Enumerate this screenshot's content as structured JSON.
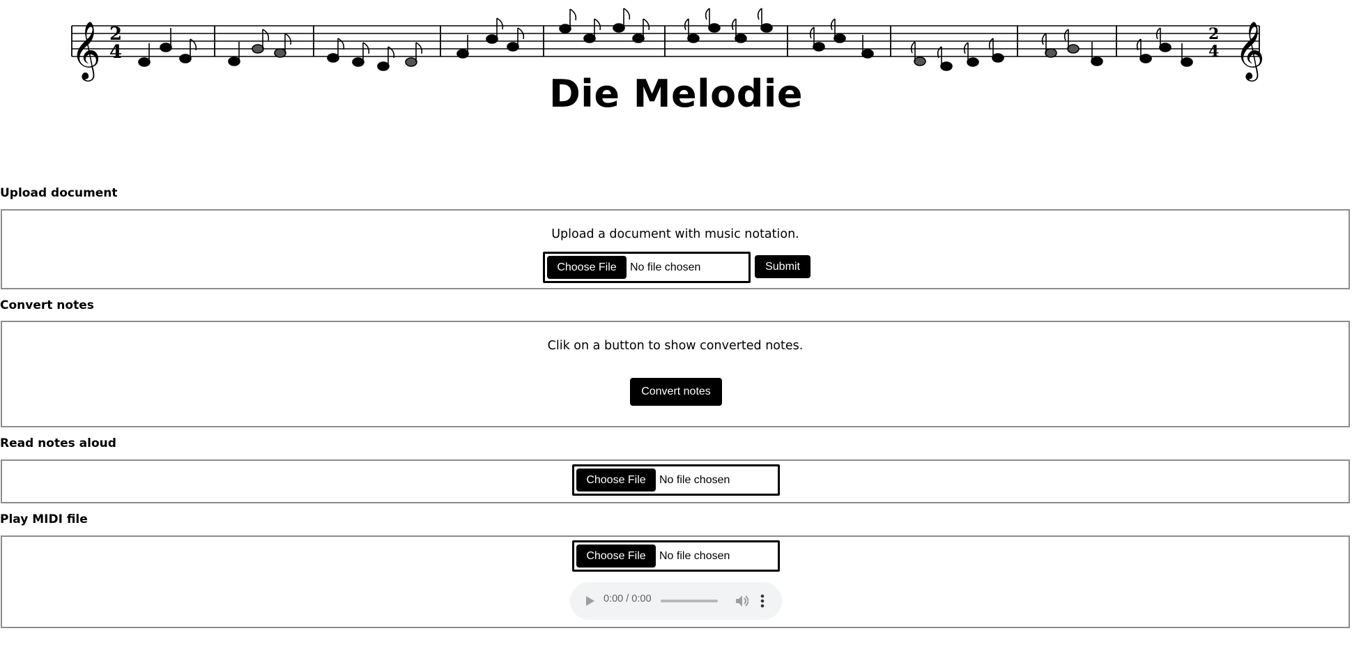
{
  "page": {
    "title": "Die Melodie",
    "banner_time_signature": "2/4"
  },
  "sections": {
    "upload": {
      "heading": "Upload document",
      "instruction": "Upload a document with music notation.",
      "choose_file_label": "Choose File",
      "file_status": "No file chosen",
      "submit_label": "Submit"
    },
    "convert": {
      "heading": "Convert notes",
      "instruction": "Clik on a button to show converted notes.",
      "button_label": "Convert notes"
    },
    "read_aloud": {
      "heading": "Read notes aloud",
      "choose_file_label": "Choose File",
      "file_status": "No file chosen"
    },
    "play_midi": {
      "heading": "Play MIDI file",
      "choose_file_label": "Choose File",
      "file_status": "No file chosen",
      "audio": {
        "time": "0:00 / 0:00",
        "progress": 0
      }
    }
  },
  "icons": {
    "banner": "music-staff",
    "audio_play": "play-icon",
    "audio_volume": "volume-icon",
    "audio_menu": "more-vert-icon"
  },
  "colors": {
    "button_bg": "#000000",
    "button_text": "#ffffff",
    "section_border": "#8c8c8c",
    "audio_bg": "#f1f3f4"
  }
}
